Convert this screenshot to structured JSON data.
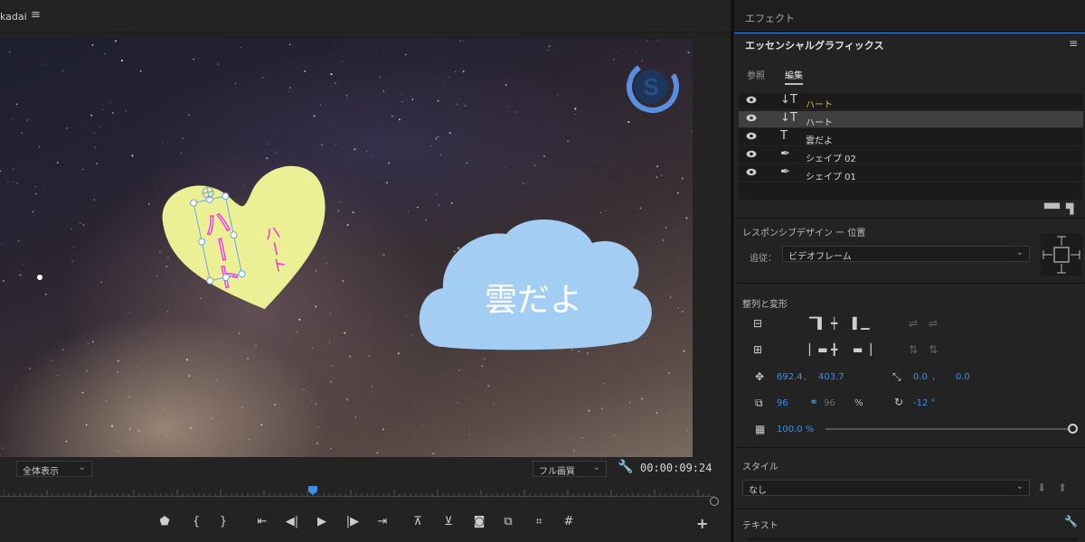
{
  "monitor": {
    "title_partial": "kadai",
    "menu_icon": "menu-icon",
    "zoom_select": "全体表示",
    "quality_select": "フル画質",
    "timecode": "00:00:09:24",
    "canvas": {
      "heart_text_selected": "ハート",
      "heart_text_second": "ハート",
      "cloud_text": "雲だよ",
      "colors": {
        "heart": "#ecf094",
        "cloud": "#a4cdf4",
        "heart_text": "#f03ad7"
      }
    },
    "playhead_position": 0.44
  },
  "effects": {
    "tab_label": "エフェクト"
  },
  "eg": {
    "title": "エッセンシャルグラフィックス",
    "tabs": [
      "参照",
      "編集"
    ],
    "active_tab": "編集",
    "layers": [
      {
        "name": "ハート",
        "type": "vertical-text-icon",
        "type_glyph": "↓T",
        "color": "gold"
      },
      {
        "name": "ハート",
        "type": "vertical-text-icon",
        "type_glyph": "↓T",
        "color": "white",
        "selected": true
      },
      {
        "name": "雲だよ",
        "type": "text-icon",
        "type_glyph": "T",
        "color": "white"
      },
      {
        "name": "シェイプ 02",
        "type": "pen-icon",
        "type_glyph": "✒",
        "color": "white"
      },
      {
        "name": "シェイプ 01",
        "type": "pen-icon",
        "type_glyph": "✒",
        "color": "white"
      }
    ],
    "responsive": {
      "heading": "レスポンシブデザイン ー 位置",
      "follow_label": "追従：",
      "follow_value": "ビデオフレーム"
    },
    "align": {
      "heading": "整列と変形",
      "position_x": "692.4",
      "position_sep": ",",
      "position_y": "403.7",
      "anchor_x": "0.0",
      "anchor_sep": ",",
      "anchor_y": "0.0",
      "scale_w": "96",
      "scale_h": "96",
      "scale_unit": "%",
      "rotation": "-12 °",
      "opacity": "100.0 %"
    },
    "style": {
      "heading": "スタイル",
      "value": "なし"
    },
    "text": {
      "heading": "テキスト"
    }
  }
}
